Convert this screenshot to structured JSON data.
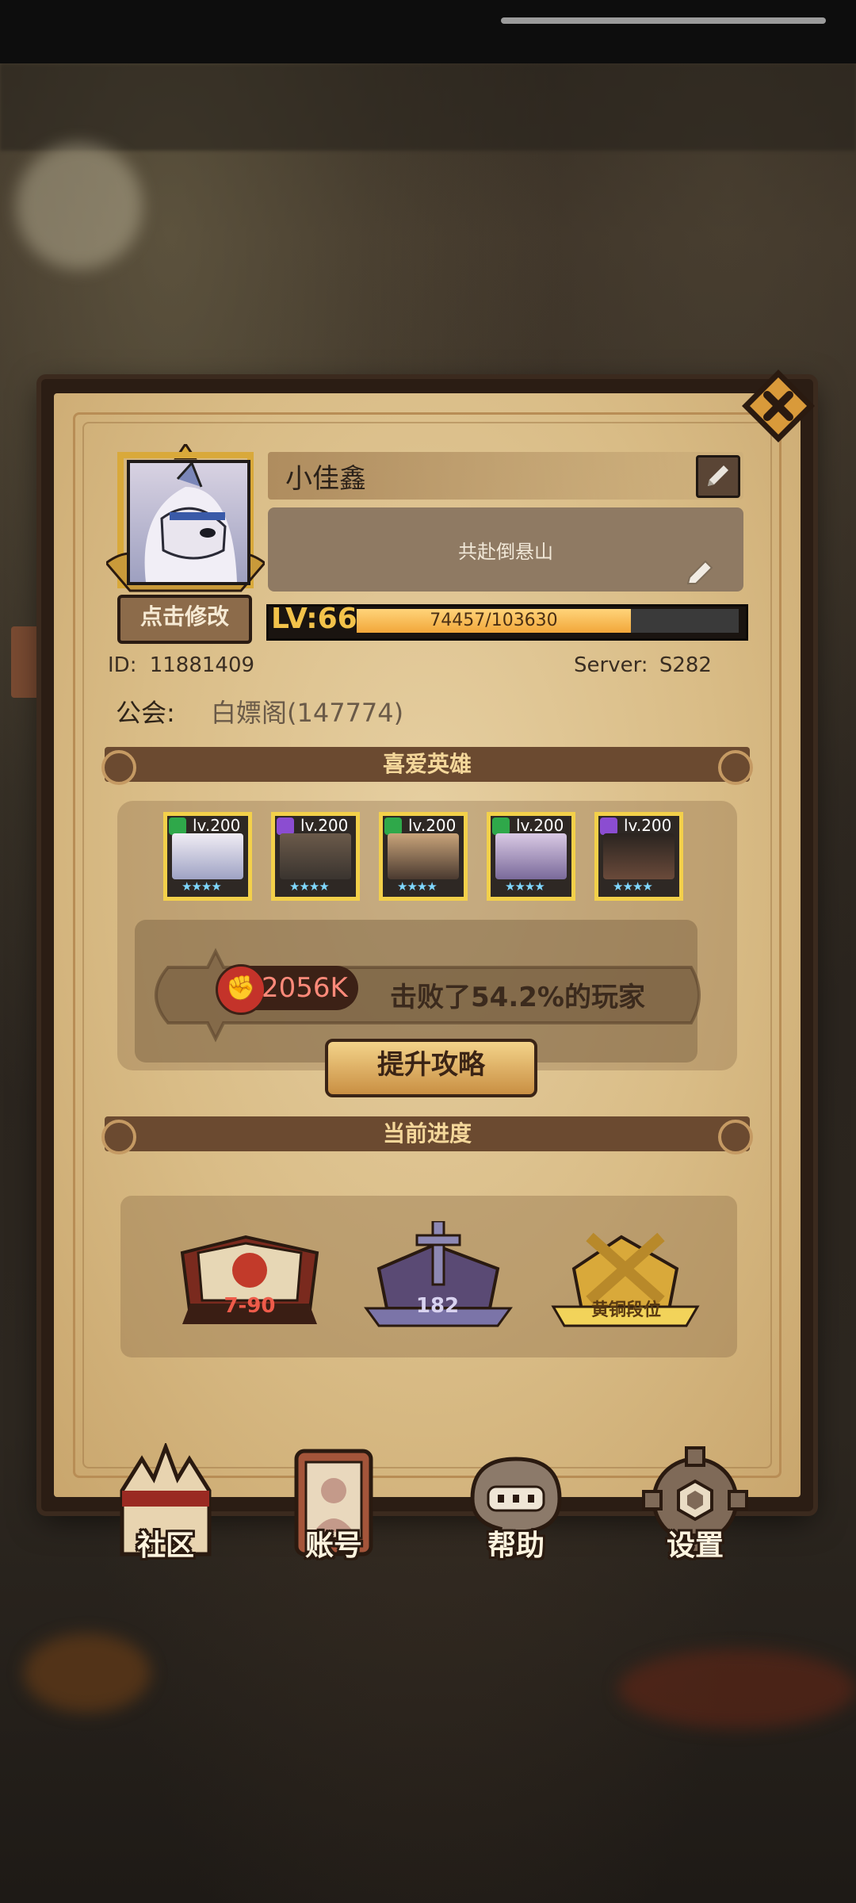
{
  "profile": {
    "name": "小佳鑫",
    "motto": "共赴倒悬山",
    "edit_avatar_label": "点击修改",
    "level_label": "LV:66",
    "xp_text": "74457/103630",
    "xp_progress": 0.718,
    "id_label": "ID:",
    "id_value": "11881409",
    "server_label": "Server:",
    "server_value": "S282",
    "guild_label": "公会:",
    "guild_value": "白嫖阁(147774)"
  },
  "favorite_heroes": {
    "title": "喜爱英雄",
    "heroes": [
      {
        "level": "lv.200",
        "class_color": "#2fa84a",
        "class_icon": "sword-class-icon",
        "stars": "★★★★"
      },
      {
        "level": "lv.200",
        "class_color": "#8b4dd1",
        "class_icon": "magic-class-icon",
        "stars": "★★★★"
      },
      {
        "level": "lv.200",
        "class_color": "#2fa84a",
        "class_icon": "healer-class-icon",
        "stars": "★★★★"
      },
      {
        "level": "lv.200",
        "class_color": "#2fa84a",
        "class_icon": "support-class-icon",
        "stars": "★★★★"
      },
      {
        "level": "lv.200",
        "class_color": "#8b4dd1",
        "class_icon": "assassin-class-icon",
        "stars": "★★★★"
      }
    ],
    "power_value": "2056K",
    "beat_text": "击败了54.2%的玩家",
    "strategy_button": "提升攻略"
  },
  "current_progress": {
    "title": "当前进度",
    "items": [
      {
        "label": "7-90",
        "icon": "campaign-book-icon",
        "color": "#e25a4a"
      },
      {
        "label": "182",
        "icon": "tower-sword-icon",
        "color": "#b9b4d9"
      },
      {
        "label": "黄铜段位",
        "icon": "arena-bronze-icon",
        "color": "#5a3a12"
      }
    ]
  },
  "bottom_nav": {
    "community": "社区",
    "account": "账号",
    "help": "帮助",
    "settings": "设置"
  },
  "colors": {
    "paper": "#dcc08b",
    "frame": "#2b1d14",
    "gold": "#f3d04a",
    "xp_fill": "#f2a73a"
  }
}
